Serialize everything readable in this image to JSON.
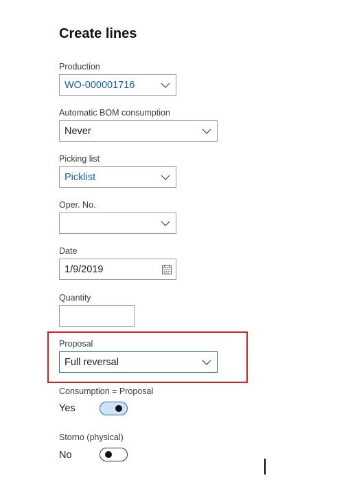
{
  "title": "Create lines",
  "fields": {
    "production": {
      "label": "Production",
      "value": "WO-000001716"
    },
    "bom": {
      "label": "Automatic BOM consumption",
      "value": "Never"
    },
    "picking": {
      "label": "Picking list",
      "value": "Picklist"
    },
    "oper": {
      "label": "Oper. No.",
      "value": ""
    },
    "date": {
      "label": "Date",
      "value": "1/9/2019"
    },
    "quantity": {
      "label": "Quantity",
      "value": ""
    },
    "proposal": {
      "label": "Proposal",
      "value": "Full reversal"
    },
    "consumption": {
      "label": "Consumption = Proposal",
      "state": "Yes",
      "on": true
    },
    "storno": {
      "label": "Storno (physical)",
      "state": "No",
      "on": false
    }
  },
  "colors": {
    "link": "#1a5fa8",
    "toggle_on": "#cfe3f7",
    "highlight": "#d42020"
  },
  "icons": {
    "dropdown": "chevron-down-icon",
    "calendar": "calendar-icon"
  }
}
